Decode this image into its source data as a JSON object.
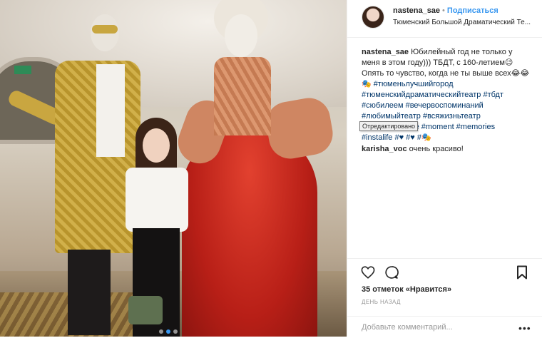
{
  "post": {
    "photo_alt": "Three people in an ornate theater lobby",
    "carousel_dots": 3,
    "carousel_active": 1
  },
  "header": {
    "username": "nastena_sae",
    "separator": "•",
    "follow_label": "Подписаться",
    "location": "Тюменский Большой Драматический Те..."
  },
  "caption": {
    "username": "nastena_sae",
    "line1": "Юбилейный год не только у",
    "line2": "меня в этом году))) ТБДТ, с 160-летием😉",
    "line3": "Опять то чувство, когда не ты выше всех😂😂",
    "line4": "🎭 #тюменьлучшийгород",
    "line5": "#тюменскийдраматическийтеатр #тбдт",
    "line6": "#сюбилеем #вечервоспоминаний",
    "line7": "#любимыйтеатр #всяжизньтеатр",
    "line8": "#drama #theatre #moment #memories",
    "line9": "#instalife #♥ #♥ #🎭"
  },
  "tooltip": {
    "text": "Отредактировано"
  },
  "comments": [
    {
      "username": "karisha_voc",
      "text": "очень красиво!"
    }
  ],
  "actions": {
    "like_icon": "heart-icon",
    "comment_icon": "speech-bubble-icon",
    "save_icon": "bookmark-icon",
    "likes_text": "35 отметок «Нравится»",
    "time_text": "день назад"
  },
  "add_comment": {
    "placeholder": "Добавьте комментарий...",
    "more_label": "•••"
  },
  "colors": {
    "link": "#3897f0",
    "hashtag": "#003569",
    "muted": "#999999"
  }
}
